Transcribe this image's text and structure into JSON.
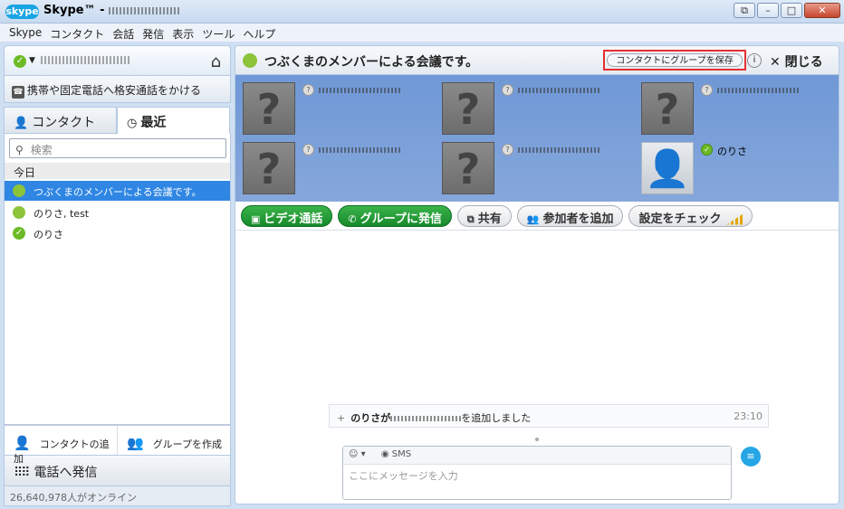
{
  "window": {
    "logo": "skype",
    "title": "Skype™ -",
    "min": "–",
    "max": "□",
    "close": "✕",
    "restore": "⧉"
  },
  "menu": [
    "Skype",
    "コンタクト",
    "会話",
    "発信",
    "表示",
    "ツール",
    "ヘルプ"
  ],
  "profile": {
    "home_icon": "⌂"
  },
  "call_phones": "携帯や固定電話へ格安通話をかける",
  "tabs": {
    "contacts": "コンタクト",
    "recent": "最近"
  },
  "search": {
    "placeholder": "検索"
  },
  "today_label": "今日",
  "recent_items": [
    {
      "label": "つぶくまのメンバーによる会議です。",
      "selected": true
    },
    {
      "label": "のりさ, test"
    },
    {
      "label": "のりさ"
    }
  ],
  "actions": {
    "add_contact": "コンタクトの追加",
    "create_group": "グループを作成"
  },
  "dial": "電話へ発信",
  "online_count": "26,640,978人がオンライン",
  "conversation": {
    "title": "つぶくまのメンバーによる会議です。",
    "save_group": "コンタクトにグループを保存",
    "info": "i",
    "close": "閉じる",
    "last_participant": "のりさ"
  },
  "toolbar": {
    "video": "ビデオ通話",
    "call_group": "グループに発信",
    "share": "共有",
    "add_participants": "参加者を追加",
    "check_settings": "設定をチェック"
  },
  "notice": {
    "prefix": "のりさが",
    "suffix": "を追加しました",
    "time": "23:10"
  },
  "compose": {
    "sms": "SMS",
    "placeholder": "ここにメッセージを入力"
  }
}
